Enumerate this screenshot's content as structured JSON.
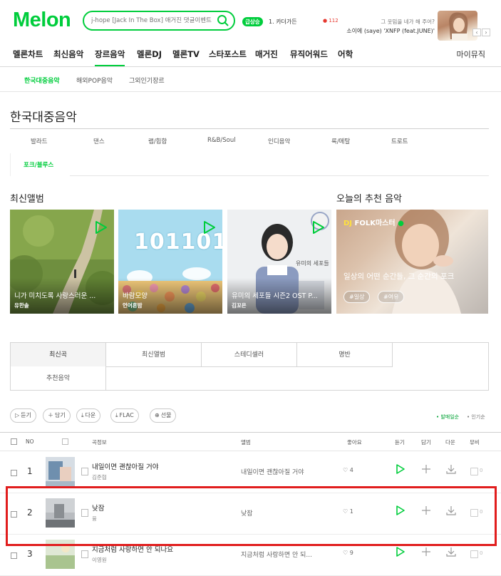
{
  "header": {
    "logo": "Melon",
    "search_placeholder": "j-hope [Jack In The Box] 애거진 댓글이벤트",
    "realtime_badge": "급상승",
    "realtime_rank": "1.",
    "realtime_keyword": "카더가든",
    "realtime_count": "112",
    "promo_line1": "그 웃밈을 네가 해 주어?",
    "promo_line2": "소이에 (saye) 'XNFP (feat.JUNE)'"
  },
  "gnb": {
    "items": [
      "멜론차트",
      "최신음악",
      "장르음악",
      "멜론DJ",
      "멜론TV",
      "스타포스트",
      "매거진",
      "뮤직어워드",
      "어학"
    ],
    "my_music": "마이뮤직"
  },
  "subnav": {
    "items": [
      "한국대중음악",
      "해외POP음악",
      "그외인기장르"
    ]
  },
  "page_title": "한국대중음악",
  "genres": [
    "발라드",
    "댄스",
    "랩/힙합",
    "R&B/Soul",
    "인디음악",
    "록/메탈",
    "트로트",
    "포크/블루스"
  ],
  "sections": {
    "latest_albums": "최신앨범",
    "today_recommend": "오늘의 추천 음악"
  },
  "albums": [
    {
      "title": "니가 미치도록 사랑스러운 ...",
      "artist": "유한솔"
    },
    {
      "title": "바람모양",
      "artist": "언어흔밤"
    },
    {
      "title": "유미의 세포들 시즌2 OST P...",
      "artist": "김꼬은"
    }
  ],
  "album_art_text": {
    "album2": "101101",
    "album3": "유미의 세포들"
  },
  "dj": {
    "badge_dj": "DJ",
    "badge_name": "FOLK마스터",
    "desc": "일상의 어떤 순간들, 그 순간의 포크",
    "tags": [
      "#일상",
      "#여유"
    ]
  },
  "tabs": [
    "최신곡",
    "최신앨범",
    "스테디셀러",
    "명반",
    "추천음악"
  ],
  "toolbar": {
    "play": "듣기",
    "add": "담기",
    "download": "다운",
    "flac": "FLAC",
    "gift": "선물",
    "sort_release": "• 발매일순",
    "sort_popular": "• 인기순"
  },
  "table_headers": {
    "no": "NO",
    "song_info": "곡정보",
    "album": "앨범",
    "like": "좋아요",
    "play": "듣기",
    "add": "담기",
    "download": "다운",
    "mv": "뮤비"
  },
  "rows": [
    {
      "num": "1",
      "title": "내일이면 괜찮아질 거야",
      "artist": "김준협",
      "album": "내일이면 괜찮아질 거야",
      "likes": "4",
      "mv": "0"
    },
    {
      "num": "2",
      "title": "낮잠",
      "artist": "융",
      "album": "낮잠",
      "likes": "1",
      "mv": "0"
    },
    {
      "num": "3",
      "title": "지금처럼 사랑하면 안 되나요",
      "artist": "이영원",
      "album": "지금처럼 사랑하면 안 되...",
      "likes": "9",
      "mv": "0"
    }
  ],
  "colors": {
    "brand": "#00cd3c",
    "highlight": "#e11d1d"
  }
}
